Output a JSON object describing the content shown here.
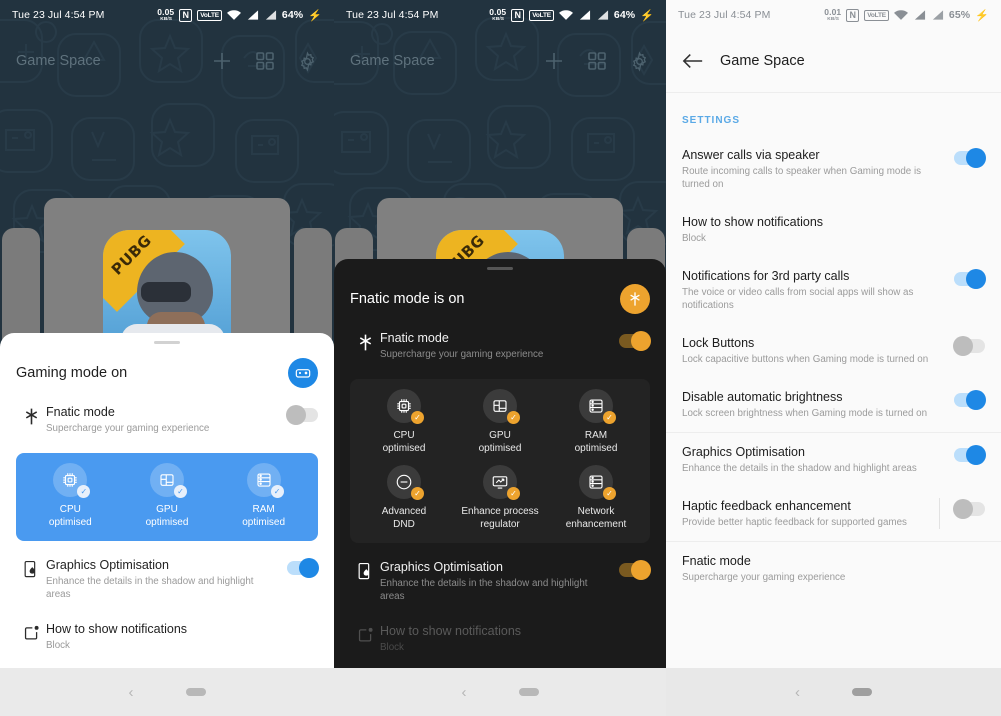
{
  "panels": [
    {
      "id": "gaming-mode-sheet",
      "statusbar": {
        "clock": "Tue 23 Jul 4:54 PM",
        "speed_value": "0.05",
        "speed_unit": "KB/S",
        "nfc": "N",
        "volte": "VoLTE",
        "battery": "64%"
      },
      "header": {
        "title": "Game Space",
        "add_icon": "plus-icon",
        "grid_icon": "grid-icon",
        "settings_icon": "gear-icon"
      },
      "card": {
        "game": "PUBG"
      },
      "sheet": {
        "title": "Gaming mode on",
        "badge_icon": "gamepad-icon",
        "fnatic": {
          "title": "Fnatic mode",
          "sub": "Supercharge your gaming experience",
          "toggle": "off"
        },
        "tiles": [
          {
            "label": "CPU\noptimised",
            "line1": "CPU",
            "line2": "optimised",
            "icon": "cpu-icon",
            "checked": true
          },
          {
            "label": "GPU optimised",
            "line1": "GPU",
            "line2": "optimised",
            "icon": "gpu-icon",
            "checked": true
          },
          {
            "label": "RAM optimised",
            "line1": "RAM",
            "line2": "optimised",
            "icon": "ram-icon",
            "checked": true
          }
        ],
        "graphics": {
          "title": "Graphics Optimisation",
          "sub": "Enhance the details in the shadow and highlight areas",
          "toggle": "on"
        },
        "notifications": {
          "title": "How to show notifications",
          "sub": "Block"
        }
      }
    },
    {
      "id": "fnatic-mode-sheet",
      "statusbar": {
        "clock": "Tue 23 Jul 4:54 PM",
        "speed_value": "0.05",
        "speed_unit": "KB/S",
        "nfc": "N",
        "volte": "VoLTE",
        "battery": "64%"
      },
      "header": {
        "title": "Game Space",
        "add_icon": "plus-icon",
        "grid_icon": "grid-icon",
        "settings_icon": "gear-icon"
      },
      "card": {
        "game": "PUBG"
      },
      "sheet": {
        "title": "Fnatic mode is on",
        "badge_icon": "fnatic-icon",
        "fnatic": {
          "title": "Fnatic mode",
          "sub": "Supercharge your gaming experience",
          "toggle": "on"
        },
        "tiles": [
          {
            "line1": "CPU",
            "line2": "optimised",
            "icon": "cpu-icon",
            "checked": true
          },
          {
            "line1": "GPU",
            "line2": "optimised",
            "icon": "gpu-icon",
            "checked": true
          },
          {
            "line1": "RAM",
            "line2": "optimised",
            "icon": "ram-icon",
            "checked": true
          },
          {
            "line1": "Advanced",
            "line2": "DND",
            "icon": "do-not-disturb-icon",
            "checked": true
          },
          {
            "line1": "Enhance process",
            "line2": "regulator",
            "icon": "process-regulator-icon",
            "checked": true
          },
          {
            "line1": "Network",
            "line2": "enhancement",
            "icon": "network-icon",
            "checked": true
          }
        ],
        "graphics": {
          "title": "Graphics Optimisation",
          "sub": "Enhance the details in the shadow and highlight areas",
          "toggle": "on"
        },
        "notifications": {
          "title": "How to show notifications",
          "sub": "Block"
        }
      }
    },
    {
      "id": "game-space-settings",
      "statusbar": {
        "clock": "Tue 23 Jul 4:54 PM",
        "speed_value": "0.01",
        "speed_unit": "KB/S",
        "nfc": "N",
        "volte": "VoLTE",
        "battery": "65%"
      },
      "appbar": {
        "back_icon": "back-arrow-icon",
        "title": "Game Space"
      },
      "section_label": "SETTINGS",
      "settings": [
        {
          "title": "Answer calls via speaker",
          "sub": "Route incoming calls to speaker when Gaming mode is turned on",
          "toggle": "on"
        },
        {
          "title": "How to show notifications",
          "sub": "Block",
          "toggle": "none"
        },
        {
          "title": "Notifications for 3rd party calls",
          "sub": "The voice or video calls from social apps will show as notifications",
          "toggle": "on"
        },
        {
          "title": "Lock Buttons",
          "sub": "Lock capacitive buttons when Gaming mode is turned on",
          "toggle": "off"
        },
        {
          "title": "Disable automatic brightness",
          "sub": "Lock screen brightness when Gaming mode is turned on",
          "toggle": "on"
        },
        {
          "title": "Graphics Optimisation",
          "sub": "Enhance the details in the shadow and highlight areas",
          "toggle": "on"
        },
        {
          "title": "Haptic feedback enhancement",
          "sub": "Provide better haptic feedback for supported games",
          "toggle": "off",
          "separator": true
        },
        {
          "title": "Fnatic mode",
          "sub": "Supercharge your gaming experience",
          "toggle": "none"
        }
      ]
    }
  ],
  "navbar": {
    "back_icon": "nav-back-icon",
    "home_icon": "nav-home-pill"
  },
  "colors": {
    "accent_blue": "#1e88e5",
    "accent_orange": "#eda32e",
    "tile_blue": "#4a9af0",
    "settings_label": "#5aa9e6",
    "game_space_bg": "#22333f",
    "dark_sheet": "#1b1b1b"
  }
}
